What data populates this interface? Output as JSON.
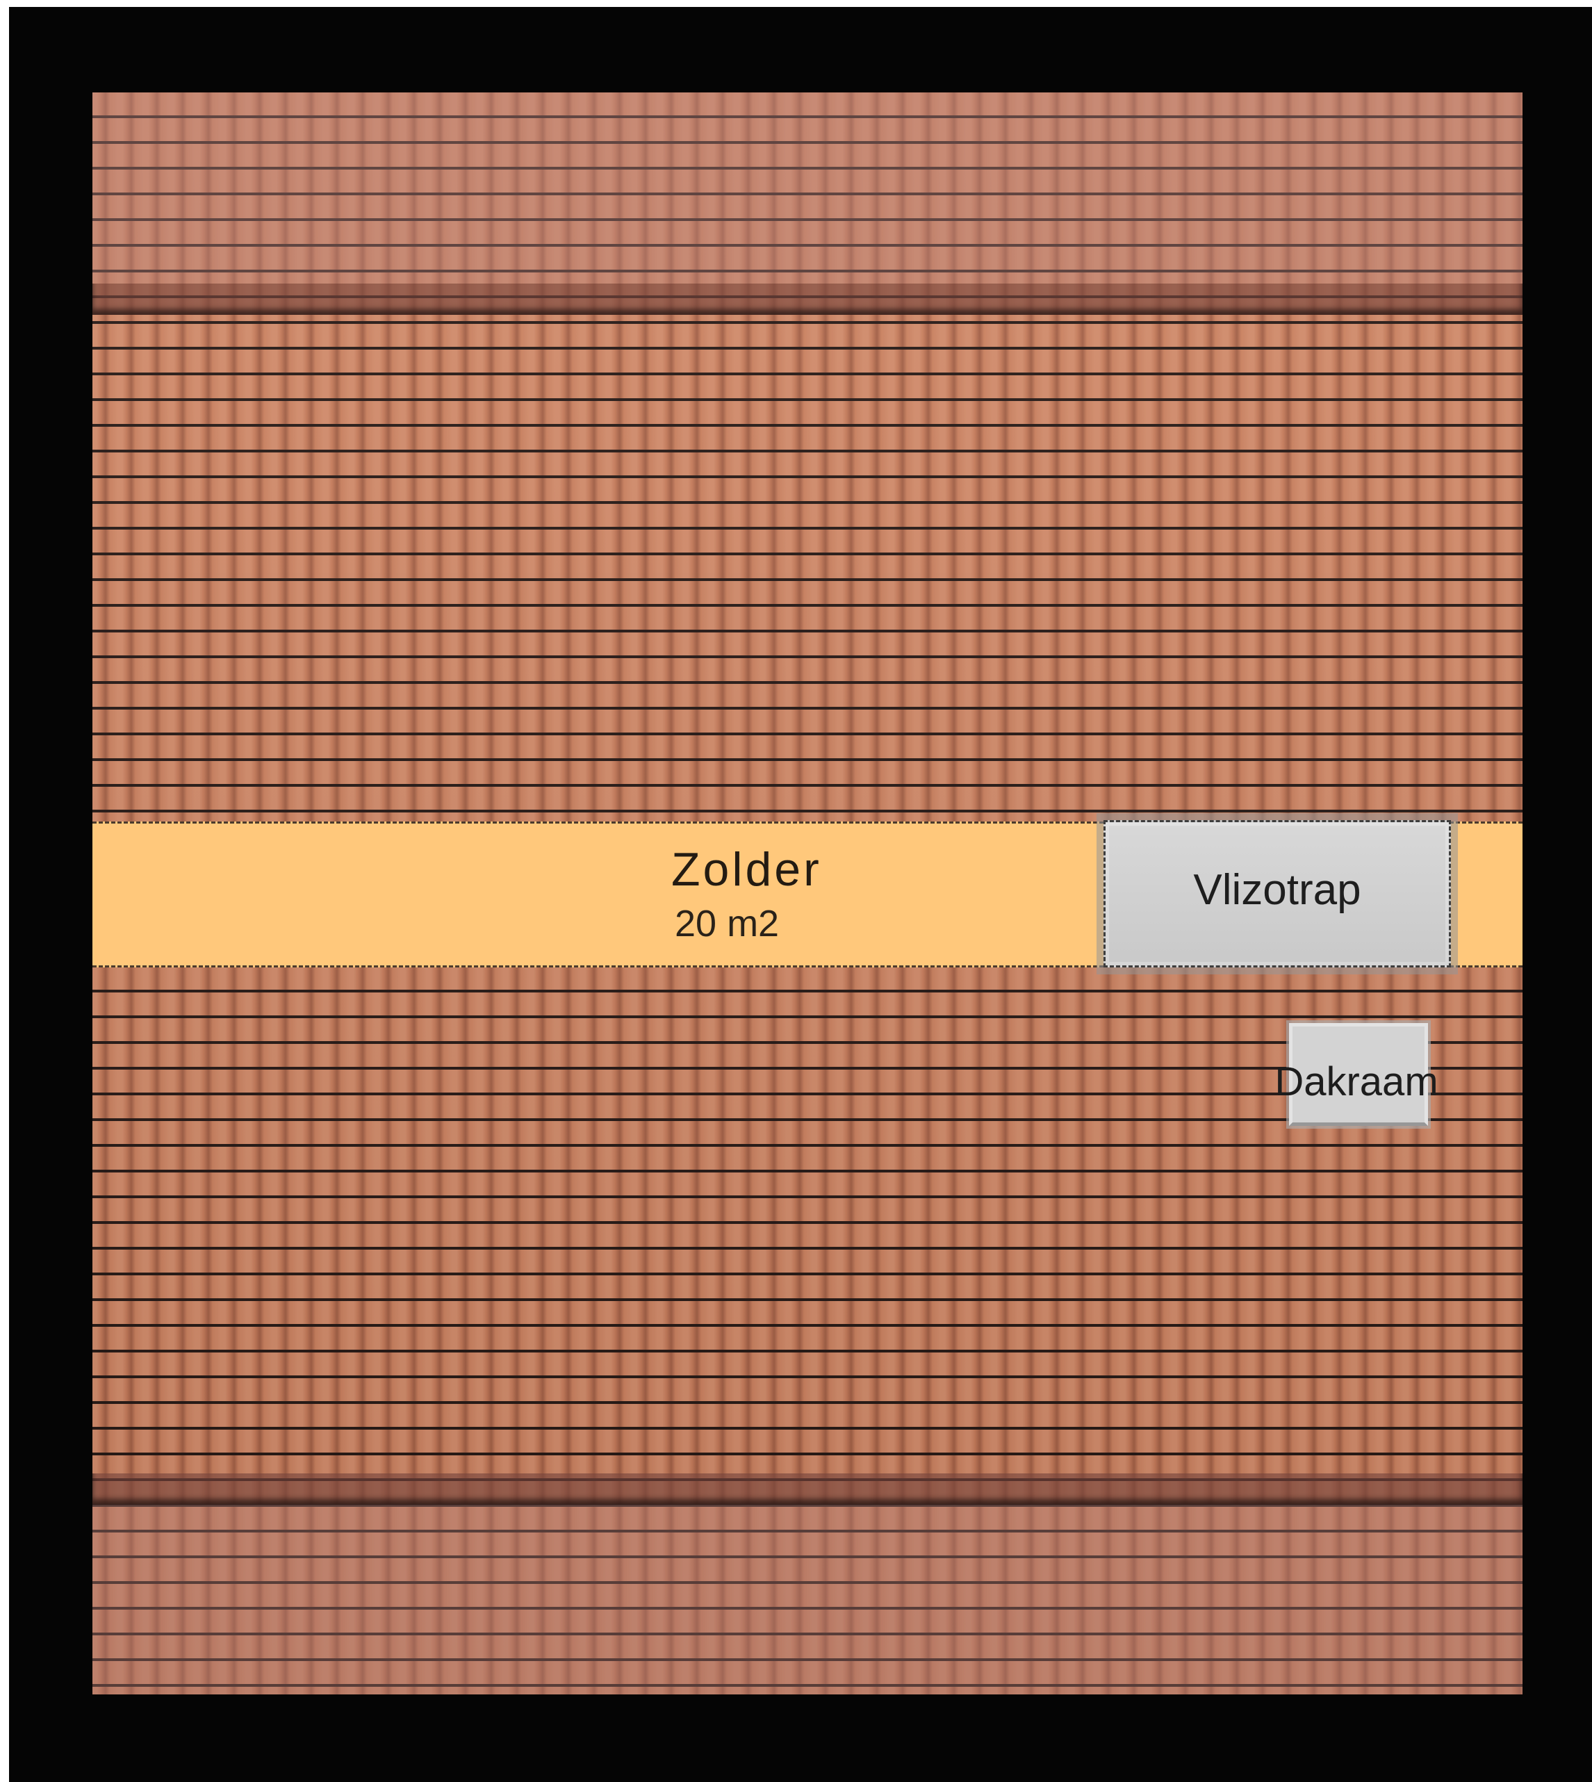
{
  "floor_plan": {
    "room": {
      "name": "Zolder",
      "area": "20 m2",
      "fill_color": "#ffc87b"
    },
    "features": {
      "stair_label": "Vlizotrap",
      "skylight_label": "Dakraam"
    },
    "colors": {
      "outer_wall": "#050505",
      "roof_tiles": "#c77d5c",
      "hatch_fill": "#d3d3d3"
    }
  }
}
